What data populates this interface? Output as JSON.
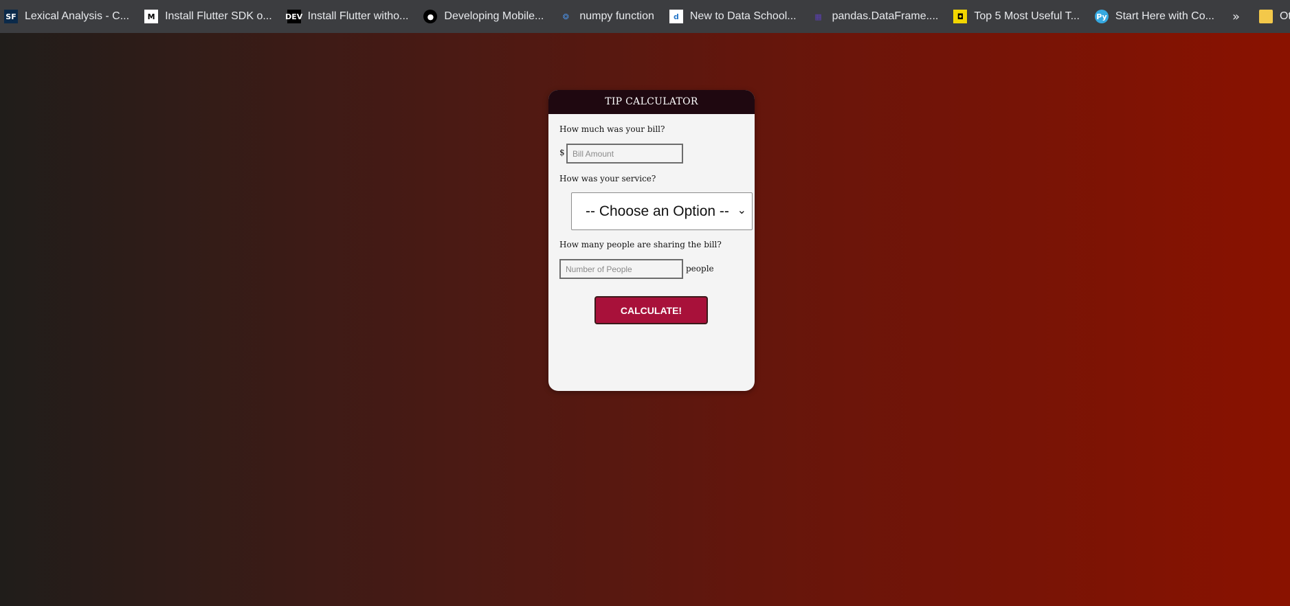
{
  "bookmarks": {
    "items": [
      {
        "label": "Lexical Analysis - C...",
        "icon": "sf-icon",
        "glyph": "SF"
      },
      {
        "label": "Install Flutter SDK o...",
        "icon": "medium-icon",
        "glyph": "M"
      },
      {
        "label": "Install Flutter witho...",
        "icon": "dev-icon",
        "glyph": "DEV"
      },
      {
        "label": "Developing Mobile...",
        "icon": "github-icon",
        "glyph": "●"
      },
      {
        "label": "numpy function",
        "icon": "numpy-icon",
        "glyph": "❂"
      },
      {
        "label": "New to Data School...",
        "icon": "dataschool-icon",
        "glyph": "d"
      },
      {
        "label": "pandas.DataFrame....",
        "icon": "pandas-icon",
        "glyph": "▦"
      },
      {
        "label": "Top 5 Most Useful T...",
        "icon": "top5-icon",
        "glyph": "◘"
      },
      {
        "label": "Start Here with Co...",
        "icon": "python-icon",
        "glyph": "Py"
      }
    ],
    "overflow_glyph": "»",
    "other_label": "Other bookmar"
  },
  "calculator": {
    "title": "TIP CALCULATOR",
    "bill_question": "How much was your bill?",
    "currency_symbol": "$",
    "bill_placeholder": "Bill Amount",
    "service_question": "How was your service?",
    "service_selected": "-- Choose an Option --",
    "service_arrow": "⌄",
    "people_question": "How many people are sharing the bill?",
    "people_placeholder": "Number of People",
    "people_unit": "people",
    "calculate_label": "CALCULATE!"
  },
  "colors": {
    "header_bg": "#1f0810",
    "button_bg": "#a8113a",
    "card_bg": "#f4f4f4",
    "bookmarks_bg": "#3c3d40"
  }
}
